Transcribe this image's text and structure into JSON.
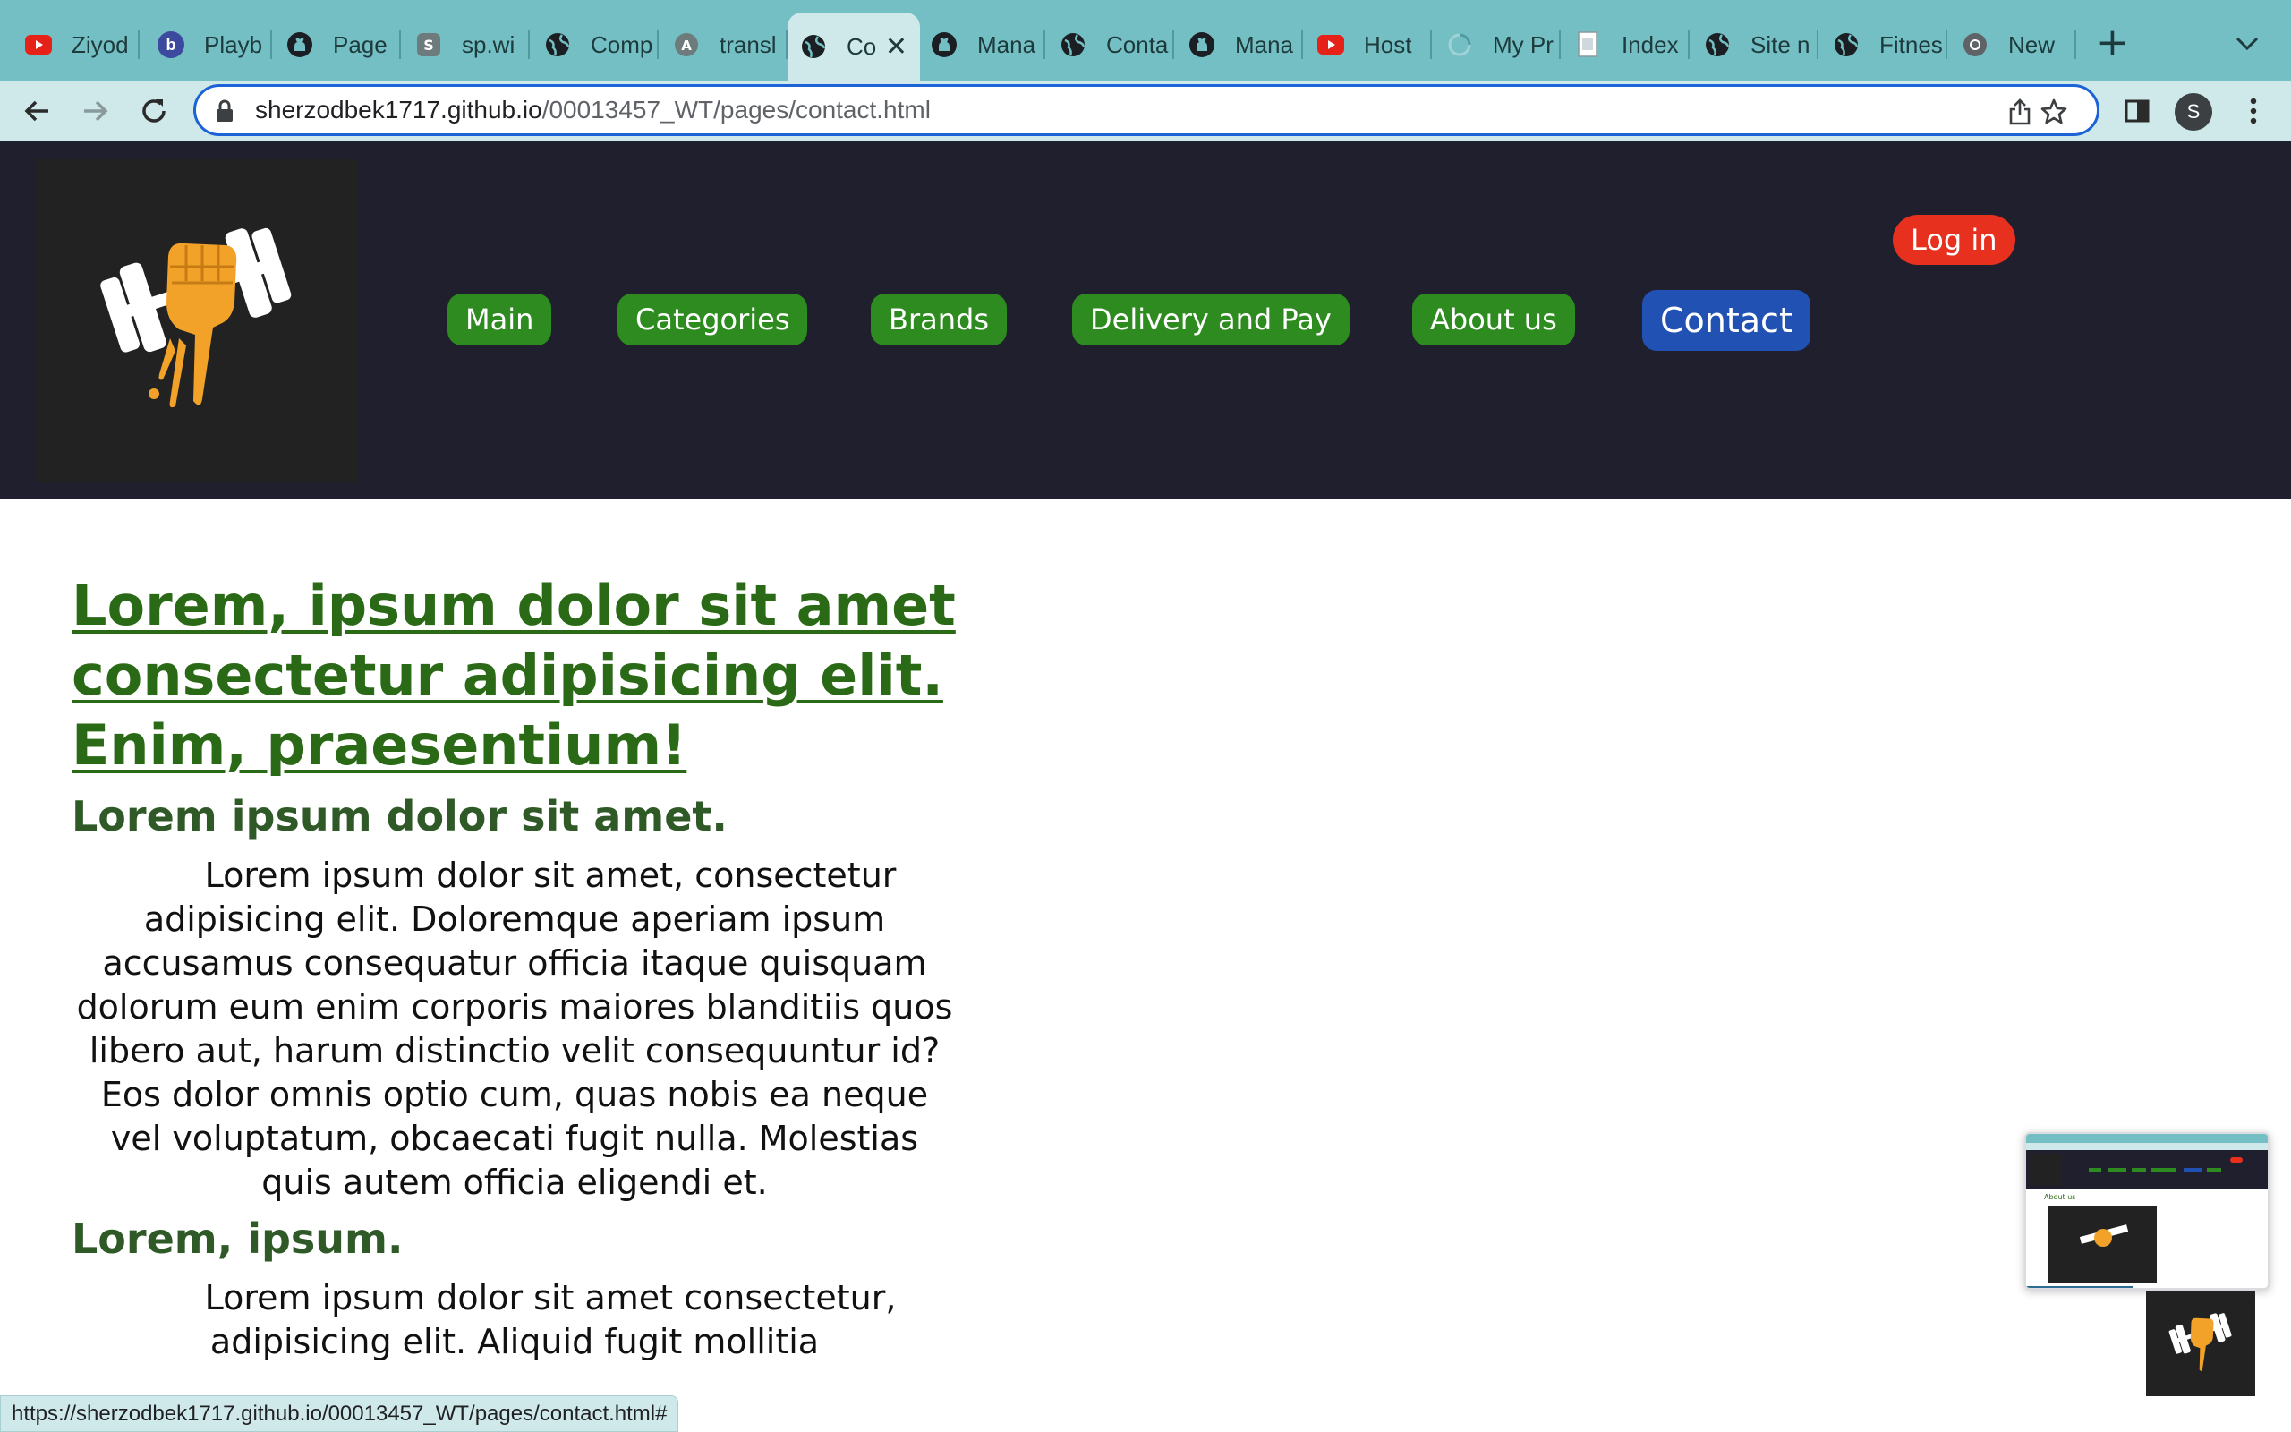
{
  "browser": {
    "tabs": [
      {
        "title": "Ziyod",
        "icon": "youtube-icon",
        "color": "#e62117"
      },
      {
        "title": "Playb",
        "icon": "b-letter-icon",
        "color": "#3b4a9e"
      },
      {
        "title": "Page",
        "icon": "github-icon",
        "color": "#1b1f23"
      },
      {
        "title": "sp.wi",
        "icon": "sp-icon",
        "color": "#6e7b7c"
      },
      {
        "title": "Comp",
        "icon": "globe-icon",
        "color": "#1b1f23"
      },
      {
        "title": "transl",
        "icon": "translate-icon",
        "color": "#6e7b7c"
      },
      {
        "title": "Co",
        "icon": "globe-icon",
        "color": "#1b1f23",
        "active": true
      },
      {
        "title": "Mana",
        "icon": "github-icon",
        "color": "#1b1f23"
      },
      {
        "title": "Conta",
        "icon": "globe-icon",
        "color": "#1b1f23"
      },
      {
        "title": "Mana",
        "icon": "github-icon",
        "color": "#1b1f23"
      },
      {
        "title": "Host",
        "icon": "youtube-icon",
        "color": "#e62117"
      },
      {
        "title": "My Pr",
        "icon": "loading-icon",
        "color": "#74bfc4"
      },
      {
        "title": "Index",
        "icon": "document-icon",
        "color": "#ffffff"
      },
      {
        "title": "Site n",
        "icon": "globe-icon",
        "color": "#1b1f23"
      },
      {
        "title": "Fitnes",
        "icon": "globe-icon",
        "color": "#1b1f23"
      },
      {
        "title": "New",
        "icon": "chrome-icon",
        "color": "#5f6368"
      }
    ],
    "url_host": "sherzodbek1717.github.io",
    "url_path": "/00013457_WT/pages/contact.html",
    "profile_initial": "S",
    "status_url": "https://sherzodbek1717.github.io/00013457_WT/pages/contact.html#"
  },
  "site": {
    "nav": [
      {
        "label": "Main"
      },
      {
        "label": "Categories"
      },
      {
        "label": "Brands"
      },
      {
        "label": "Delivery and Pay"
      },
      {
        "label": "About us"
      },
      {
        "label": "Contact",
        "active": true
      }
    ],
    "login_label": "Log in",
    "colors": {
      "header_bg": "#1f1f2e",
      "nav_bg": "#2e8b1f",
      "nav_active_bg": "#2151b3",
      "login_bg": "#e8301f",
      "heading": "#2a6a16"
    }
  },
  "content": {
    "title": "Lorem, ipsum dolor sit amet consectetur adipisicing elit. Enim, praesentium!",
    "subtitle1": "Lorem ipsum dolor sit amet.",
    "para1": "Lorem ipsum dolor sit amet, consectetur adipisicing elit. Doloremque aperiam ipsum accusamus consequatur officia itaque quisquam dolorum eum enim corporis maiores blanditiis quos libero aut, harum distinctio velit consequuntur id? Eos dolor omnis optio cum, quas nobis ea neque vel voluptatum, obcaecati fugit nulla. Molestias quis autem officia eligendi et.",
    "subtitle2": "Lorem, ipsum.",
    "para2": "Lorem ipsum dolor sit amet consectetur, adipisicing elit. Aliquid fugit mollitia"
  },
  "preview": {
    "heading": "About us"
  }
}
